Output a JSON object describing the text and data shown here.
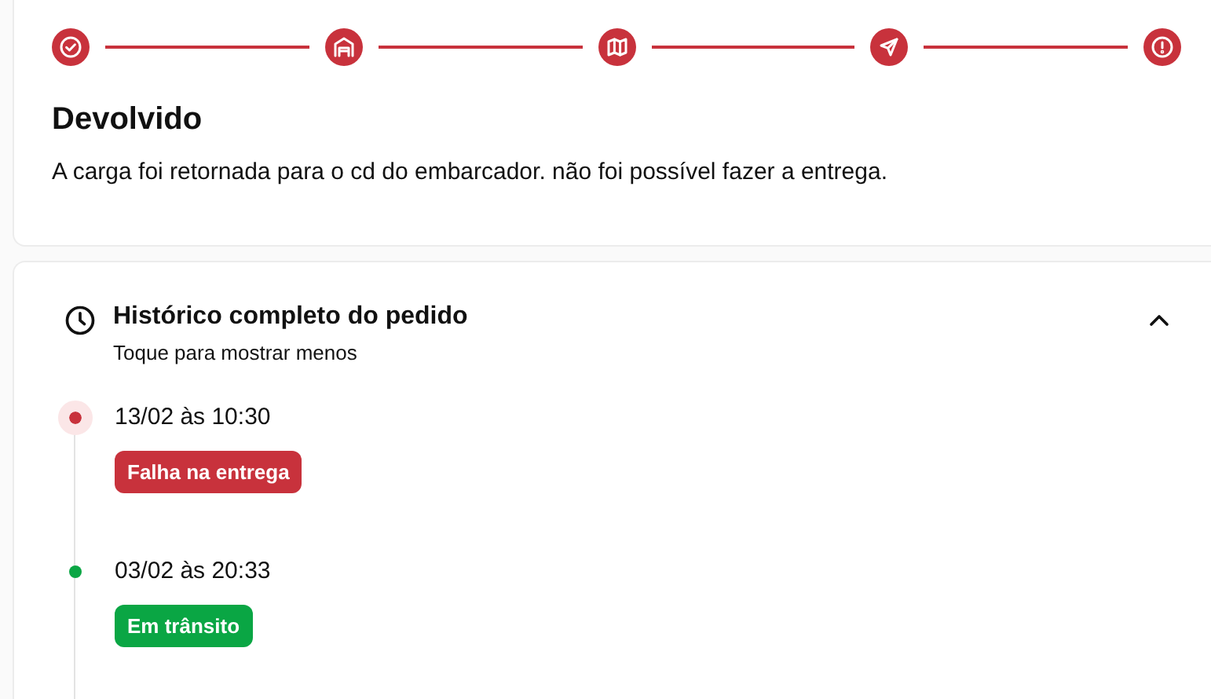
{
  "steps": [
    {
      "kind": "check"
    },
    {
      "kind": "warehouse"
    },
    {
      "kind": "map"
    },
    {
      "kind": "send"
    },
    {
      "kind": "alert"
    }
  ],
  "status": {
    "title": "Devolvido",
    "description": "A carga foi retornada para o cd do embarcador. não foi possível fazer a entrega."
  },
  "history": {
    "title": "Histórico completo do pedido",
    "subtitle": "Toque para mostrar menos",
    "expanded": true,
    "events": [
      {
        "date": "13/02 às 10:30",
        "label": "Falha na entrega",
        "color": "#c8323c",
        "current": true
      },
      {
        "date": "03/02 às 20:33",
        "label": "Em trânsito",
        "color": "#0aa644",
        "current": false
      }
    ]
  }
}
